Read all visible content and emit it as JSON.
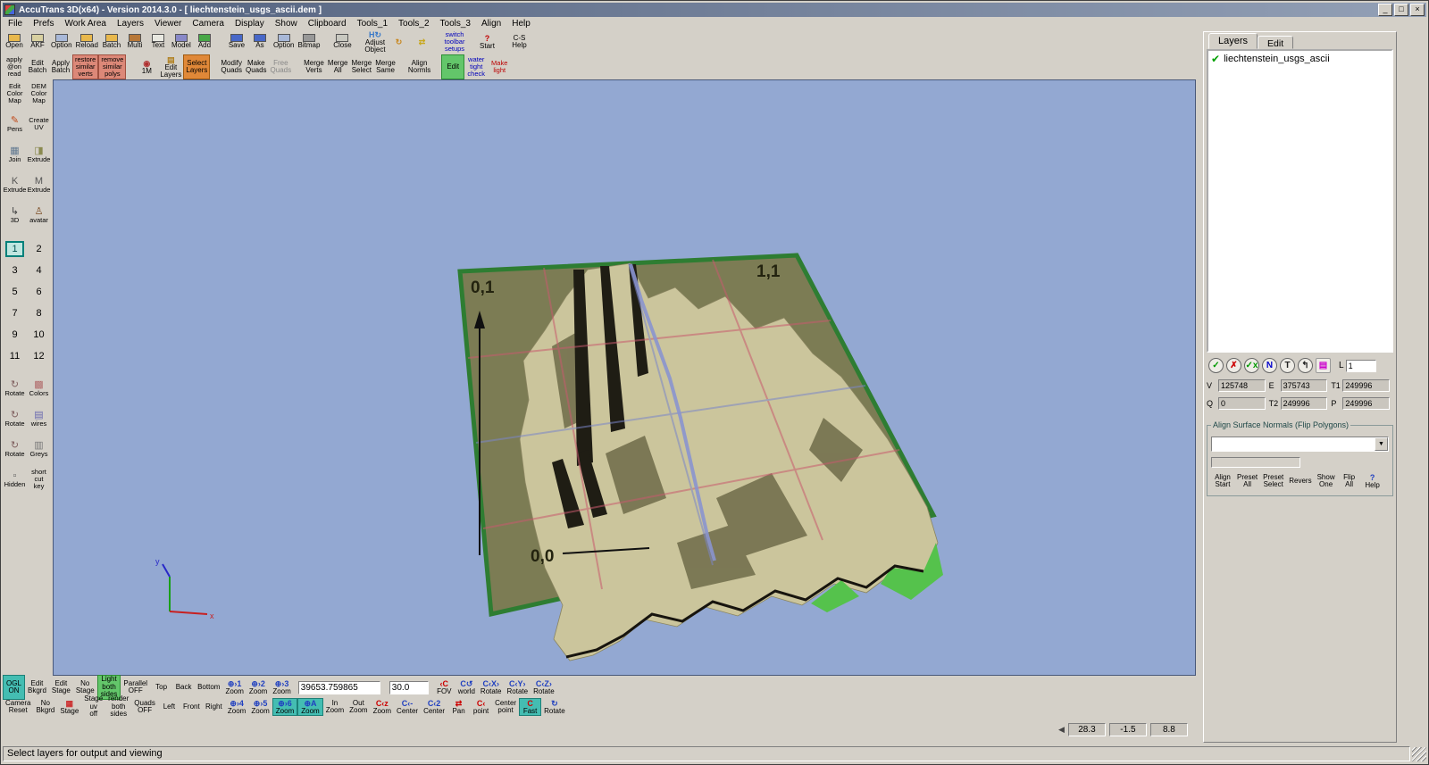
{
  "window": {
    "title": "AccuTrans 3D(x64) - Version 2014.3.0 - [ liechtenstein_usgs_ascii.dem ]",
    "minimize": "_",
    "maximize": "□",
    "close": "×"
  },
  "menu": [
    "File",
    "Prefs",
    "Work Area",
    "Layers",
    "Viewer",
    "Camera",
    "Display",
    "Show",
    "Clipboard",
    "Tools_1",
    "Tools_2",
    "Tools_3",
    "Align",
    "Help"
  ],
  "toolbar_row1": [
    {
      "l1": "Open",
      "ico": "#e8b84c"
    },
    {
      "l1": "AKF",
      "ico": "#d8d0a0"
    },
    {
      "l1": "Option",
      "ico": "#a8b8d8"
    },
    {
      "l1": "Reload",
      "ico": "#e8b84c"
    },
    {
      "l1": "Batch",
      "ico": "#e8b84c"
    },
    {
      "l1": "Multi",
      "ico": "#b87838"
    },
    {
      "l1": "Text",
      "ico": "#e8e8e0"
    },
    {
      "l1": "Model",
      "ico": "#8888c8"
    },
    {
      "l1": "Add",
      "ico": "#48a848"
    },
    {
      "l1": "Save",
      "ico": "#4868c8",
      "cls": "gap"
    },
    {
      "l1": "As",
      "ico": "#4868c8"
    },
    {
      "l1": "Option",
      "ico": "#a8b8d8"
    },
    {
      "l1": "Bitmap",
      "ico": "#989898"
    },
    {
      "l1": "Close",
      "ico": "#c8c8c0",
      "cls": "gap"
    },
    {
      "l1": "Adjust",
      "l2": "Object",
      "g": "H↻",
      "gc": "#3878c8",
      "cls": "gap"
    },
    {
      "g": "↻",
      "gc": "#c88820"
    },
    {
      "g": "⇄",
      "gc": "#c8a820"
    },
    {
      "l1": "switch",
      "l2": "toolbar",
      "l3": "setups",
      "cls": "tiny blue gap"
    },
    {
      "g": "?",
      "gc": "#c00000",
      "l1": "Start",
      "cls": "gap"
    },
    {
      "l1": "C-S",
      "l2": "Help",
      "cls": "gap"
    }
  ],
  "toolbar_row2": [
    {
      "l1": "apply",
      "l2": "@on",
      "l3": "read",
      "cls": "tiny"
    },
    {
      "l1": "Edit",
      "l2": "Batch"
    },
    {
      "l1": "Apply",
      "l2": "Batch"
    },
    {
      "l1": "restore",
      "l2": "similar",
      "l3": "verts",
      "cls": "tiny chip-red"
    },
    {
      "l1": "remove",
      "l2": "similar",
      "l3": "polys",
      "cls": "tiny chip-red"
    },
    {
      "g": "◉",
      "gc": "#b03030",
      "l1": "1M",
      "cls": "gap"
    },
    {
      "g": "▤",
      "gc": "#b08020",
      "l1": "Edit",
      "l2": "Layers"
    },
    {
      "l1": "Select",
      "l2": "Layers",
      "cls": "chip-orange"
    },
    {
      "l1": "Modify",
      "l2": "Quads",
      "cls": "gap"
    },
    {
      "l1": "Make",
      "l2": "Quads"
    },
    {
      "l1": "Free",
      "l2": "Quads",
      "cls": "dim"
    },
    {
      "l1": "Merge",
      "l2": "Verts",
      "cls": "gap"
    },
    {
      "l1": "Merge",
      "l2": "All"
    },
    {
      "l1": "Merge",
      "l2": "Select"
    },
    {
      "l1": "Merge",
      "l2": "Same"
    },
    {
      "l1": "Align",
      "l2": "Normls",
      "cls": "gap"
    },
    {
      "l1": "Edit",
      "cls": "chip-green gap"
    },
    {
      "l1": "water",
      "l2": "tight",
      "l3": "check",
      "cls": "tiny blue"
    },
    {
      "l1": "Make",
      "l2": "light",
      "cls": "tiny red"
    }
  ],
  "sidebar_items": [
    {
      "l1": "Edit",
      "l2": "Color",
      "l3": "Map",
      "cls": "tiny"
    },
    {
      "l1": "DEM",
      "l2": "Color",
      "l3": "Map",
      "cls": "tiny red"
    },
    {
      "g": "✎",
      "gc": "#c04818",
      "l1": "Pens"
    },
    {
      "l1": "Create",
      "l2": "UV",
      "cls": "blue"
    },
    {
      "g": "▦",
      "gc": "#607890",
      "l1": "Join"
    },
    {
      "g": "◨",
      "gc": "#8a8a50",
      "l1": "Extrude"
    },
    {
      "g": "K",
      "gc": "#555555",
      "l1": "Extrude"
    },
    {
      "g": "M",
      "gc": "#555555",
      "l1": "Extrude"
    },
    {
      "g": "↳",
      "gc": "#404040",
      "l1": "3D"
    },
    {
      "g": "♙",
      "gc": "#7a4a20",
      "l1": "avatar"
    }
  ],
  "layers_grid": [
    {
      "n": "1",
      "cls": "sel"
    },
    {
      "n": "2"
    },
    {
      "n": "3"
    },
    {
      "n": "4"
    },
    {
      "n": "5"
    },
    {
      "n": "6"
    },
    {
      "n": "7"
    },
    {
      "n": "8"
    },
    {
      "n": "9"
    },
    {
      "n": "10"
    },
    {
      "n": "11"
    },
    {
      "n": "12"
    }
  ],
  "sidebar_items2": [
    {
      "g": "↻",
      "gc": "#806060",
      "l1": "Rotate"
    },
    {
      "g": "▩",
      "gc": "#b06868",
      "l1": "Colors"
    },
    {
      "g": "↻",
      "gc": "#806060",
      "l1": "Rotate"
    },
    {
      "g": "▤",
      "gc": "#6868b0",
      "l1": "wires"
    },
    {
      "g": "↻",
      "gc": "#806060",
      "l1": "Rotate"
    },
    {
      "g": "▥",
      "gc": "#787878",
      "l1": "Greys"
    },
    {
      "g": "▫",
      "gc": "#606060",
      "l1": "Hidden"
    },
    {
      "l1": "short",
      "l2": "cut",
      "l3": "key",
      "cls": "red tiny"
    }
  ],
  "viewport": {
    "labels": {
      "tl": "0,1",
      "tr": "1,1",
      "bl": "0,0"
    },
    "axis": {
      "x": "x",
      "y": "y"
    }
  },
  "layers_panel": {
    "tabs": [
      {
        "label": "Layers",
        "cls": "active"
      },
      {
        "label": "Edit",
        "cls": "inactive"
      }
    ],
    "layer": {
      "check": "✔",
      "name": "liechtenstein_usgs_ascii"
    },
    "tools": [
      {
        "g": "✓",
        "c": "#009900"
      },
      {
        "g": "✗",
        "c": "#cc0000"
      },
      {
        "g": "✓x",
        "c": "#009900"
      },
      {
        "g": "N",
        "c": "#0000cc"
      },
      {
        "g": "T",
        "c": "#222222"
      },
      {
        "g": "↰",
        "c": "#222222"
      },
      {
        "g": "▤",
        "c": "#cc00cc",
        "cls": "nocircle"
      }
    ],
    "l_label": "L",
    "l_value": "1",
    "fields": [
      {
        "label": "V",
        "value": "125748"
      },
      {
        "label": "E",
        "value": "375743"
      },
      {
        "label": "T1",
        "value": "249996"
      },
      {
        "label": "Q",
        "value": "0"
      },
      {
        "label": "T2",
        "value": "249996"
      },
      {
        "label": "P",
        "value": "249996"
      }
    ],
    "group_title": "Align Surface Normals (Flip Polygons)",
    "group_buttons": [
      {
        "l1": "Align",
        "l2": "Start"
      },
      {
        "l1": "Preset",
        "l2": "All"
      },
      {
        "l1": "Preset",
        "l2": "Select"
      },
      {
        "l1": "Revers",
        "cls": "tiny"
      },
      {
        "l1": "Show",
        "l2": "One"
      },
      {
        "l1": "Flip",
        "l2": "All"
      },
      {
        "g": "?",
        "gc": "#2040c0",
        "l1": "Help"
      }
    ]
  },
  "bottom": {
    "zoom_value": "39653.759865",
    "fov_value": "30.0"
  },
  "bottom_row1a": [
    {
      "l1": "OGL",
      "l2": "ON",
      "cls": "chip-teal"
    },
    {
      "l1": "Edit",
      "l2": "Bkgrd"
    },
    {
      "l1": "Edit",
      "l2": "Stage"
    },
    {
      "l1": "No",
      "l2": "Stage"
    },
    {
      "l1": "Light",
      "l2": "both",
      "l3": "sides",
      "cls": "tiny chip-green"
    },
    {
      "l1": "Parallel",
      "l2": "OFF"
    },
    {
      "l1": "Top"
    },
    {
      "l1": "Back"
    },
    {
      "l1": "Bottom",
      "cls": "red"
    },
    {
      "g": "⊕›1",
      "gc": "#2040c0",
      "l1": "Zoom"
    },
    {
      "g": "⊕›2",
      "gc": "#2040c0",
      "l1": "Zoom"
    },
    {
      "g": "⊕›3",
      "gc": "#2040c0",
      "l1": "Zoom"
    }
  ],
  "bottom_row1b": [
    {
      "g": "‹C",
      "gc": "#cc0000",
      "l1": "FOV"
    },
    {
      "g": "C↺",
      "gc": "#2040c0",
      "l1": "world"
    },
    {
      "g": "C‹X›",
      "gc": "#2040c0",
      "l1": "Rotate"
    },
    {
      "g": "C‹Y›",
      "gc": "#2040c0",
      "l1": "Rotate"
    },
    {
      "g": "C‹Z›",
      "gc": "#2040c0",
      "l1": "Rotate"
    }
  ],
  "bottom_row2": [
    {
      "l1": "Camera",
      "l2": "Reset"
    },
    {
      "l1": "No",
      "l2": "Bkgrd"
    },
    {
      "g": "▦",
      "gc": "#cc3030",
      "l1": "Stage"
    },
    {
      "l1": "Stage",
      "l2": "uv",
      "l3": "off",
      "cls": "tiny"
    },
    {
      "l1": "render",
      "l2": "both",
      "l3": "sides",
      "cls": "tiny"
    },
    {
      "l1": "Quads",
      "l2": "OFF"
    },
    {
      "l1": "Left"
    },
    {
      "l1": "Front"
    },
    {
      "l1": "Right",
      "cls": "red"
    },
    {
      "g": "⊕›4",
      "gc": "#2040c0",
      "l1": "Zoom"
    },
    {
      "g": "⊕›5",
      "gc": "#2040c0",
      "l1": "Zoom"
    },
    {
      "g": "⊕›6",
      "gc": "#2040c0",
      "l1": "Zoom",
      "cls": "chip-teal"
    },
    {
      "g": "⊕A",
      "gc": "#2040c0",
      "l1": "Zoom",
      "cls": "chip-teal"
    },
    {
      "l1": "In",
      "l2": "Zoom"
    },
    {
      "l1": "Out",
      "l2": "Zoom"
    },
    {
      "g": "C‹z",
      "gc": "#cc0000",
      "l1": "Zoom"
    },
    {
      "g": "C‹-",
      "gc": "#2040c0",
      "l1": "Center"
    },
    {
      "g": "C‹2",
      "gc": "#2040c0",
      "l1": "Center"
    },
    {
      "g": "⇄",
      "gc": "#cc0000",
      "l1": "Pan"
    },
    {
      "g": "C‹",
      "gc": "#cc0000",
      "l1": "point",
      "cls": "tiny"
    },
    {
      "l1": "Center",
      "l2": "point",
      "cls": "tiny"
    },
    {
      "g": "C",
      "gc": "#cc0000",
      "l1": "Fast",
      "cls": "chip-teal"
    },
    {
      "g": "↻",
      "gc": "#2040c0",
      "l1": "Rotate"
    }
  ],
  "status": {
    "message": "Select layers for output and viewing",
    "coords": [
      {
        "v": "28.3"
      },
      {
        "v": "-1.5"
      },
      {
        "v": "8.8"
      }
    ]
  }
}
